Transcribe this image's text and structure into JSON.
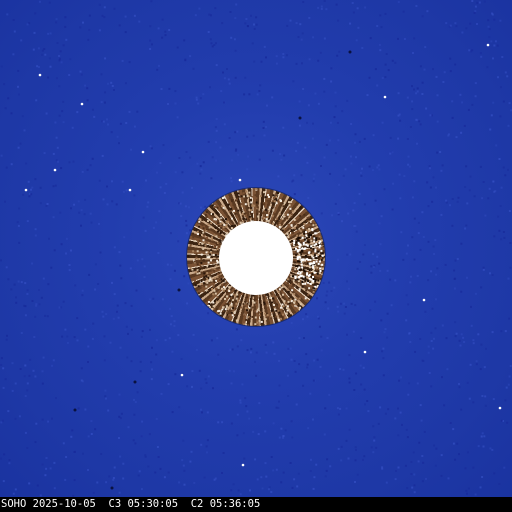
{
  "caption": {
    "observatory": "SOHO",
    "date": "2025-10-05",
    "c3_label": "C3",
    "c3_time": "05:30:05",
    "c2_label": "C2",
    "c2_time": "05:36:05"
  },
  "colors": {
    "sky": "#223dae",
    "occulter": "#ffffff",
    "corona_ring": "#6b4a30",
    "caption_bg": "#000000",
    "caption_text": "#ffffff"
  }
}
